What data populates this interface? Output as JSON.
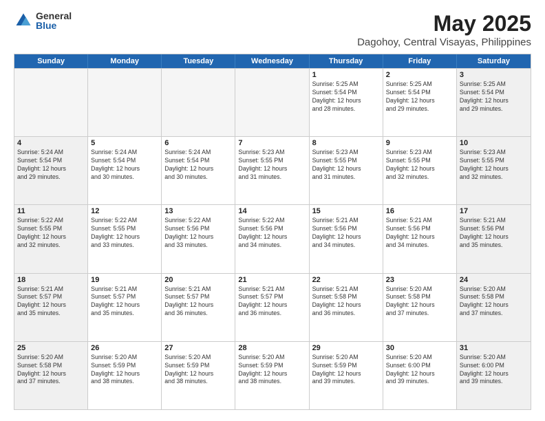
{
  "logo": {
    "general": "General",
    "blue": "Blue"
  },
  "title": "May 2025",
  "subtitle": "Dagohoy, Central Visayas, Philippines",
  "header_days": [
    "Sunday",
    "Monday",
    "Tuesday",
    "Wednesday",
    "Thursday",
    "Friday",
    "Saturday"
  ],
  "rows": [
    [
      {
        "day": "",
        "info": "",
        "empty": true
      },
      {
        "day": "",
        "info": "",
        "empty": true
      },
      {
        "day": "",
        "info": "",
        "empty": true
      },
      {
        "day": "",
        "info": "",
        "empty": true
      },
      {
        "day": "1",
        "info": "Sunrise: 5:25 AM\nSunset: 5:54 PM\nDaylight: 12 hours\nand 28 minutes."
      },
      {
        "day": "2",
        "info": "Sunrise: 5:25 AM\nSunset: 5:54 PM\nDaylight: 12 hours\nand 29 minutes."
      },
      {
        "day": "3",
        "info": "Sunrise: 5:25 AM\nSunset: 5:54 PM\nDaylight: 12 hours\nand 29 minutes."
      }
    ],
    [
      {
        "day": "4",
        "info": "Sunrise: 5:24 AM\nSunset: 5:54 PM\nDaylight: 12 hours\nand 29 minutes."
      },
      {
        "day": "5",
        "info": "Sunrise: 5:24 AM\nSunset: 5:54 PM\nDaylight: 12 hours\nand 30 minutes."
      },
      {
        "day": "6",
        "info": "Sunrise: 5:24 AM\nSunset: 5:54 PM\nDaylight: 12 hours\nand 30 minutes."
      },
      {
        "day": "7",
        "info": "Sunrise: 5:23 AM\nSunset: 5:55 PM\nDaylight: 12 hours\nand 31 minutes."
      },
      {
        "day": "8",
        "info": "Sunrise: 5:23 AM\nSunset: 5:55 PM\nDaylight: 12 hours\nand 31 minutes."
      },
      {
        "day": "9",
        "info": "Sunrise: 5:23 AM\nSunset: 5:55 PM\nDaylight: 12 hours\nand 32 minutes."
      },
      {
        "day": "10",
        "info": "Sunrise: 5:23 AM\nSunset: 5:55 PM\nDaylight: 12 hours\nand 32 minutes."
      }
    ],
    [
      {
        "day": "11",
        "info": "Sunrise: 5:22 AM\nSunset: 5:55 PM\nDaylight: 12 hours\nand 32 minutes."
      },
      {
        "day": "12",
        "info": "Sunrise: 5:22 AM\nSunset: 5:55 PM\nDaylight: 12 hours\nand 33 minutes."
      },
      {
        "day": "13",
        "info": "Sunrise: 5:22 AM\nSunset: 5:56 PM\nDaylight: 12 hours\nand 33 minutes."
      },
      {
        "day": "14",
        "info": "Sunrise: 5:22 AM\nSunset: 5:56 PM\nDaylight: 12 hours\nand 34 minutes."
      },
      {
        "day": "15",
        "info": "Sunrise: 5:21 AM\nSunset: 5:56 PM\nDaylight: 12 hours\nand 34 minutes."
      },
      {
        "day": "16",
        "info": "Sunrise: 5:21 AM\nSunset: 5:56 PM\nDaylight: 12 hours\nand 34 minutes."
      },
      {
        "day": "17",
        "info": "Sunrise: 5:21 AM\nSunset: 5:56 PM\nDaylight: 12 hours\nand 35 minutes."
      }
    ],
    [
      {
        "day": "18",
        "info": "Sunrise: 5:21 AM\nSunset: 5:57 PM\nDaylight: 12 hours\nand 35 minutes."
      },
      {
        "day": "19",
        "info": "Sunrise: 5:21 AM\nSunset: 5:57 PM\nDaylight: 12 hours\nand 35 minutes."
      },
      {
        "day": "20",
        "info": "Sunrise: 5:21 AM\nSunset: 5:57 PM\nDaylight: 12 hours\nand 36 minutes."
      },
      {
        "day": "21",
        "info": "Sunrise: 5:21 AM\nSunset: 5:57 PM\nDaylight: 12 hours\nand 36 minutes."
      },
      {
        "day": "22",
        "info": "Sunrise: 5:21 AM\nSunset: 5:58 PM\nDaylight: 12 hours\nand 36 minutes."
      },
      {
        "day": "23",
        "info": "Sunrise: 5:20 AM\nSunset: 5:58 PM\nDaylight: 12 hours\nand 37 minutes."
      },
      {
        "day": "24",
        "info": "Sunrise: 5:20 AM\nSunset: 5:58 PM\nDaylight: 12 hours\nand 37 minutes."
      }
    ],
    [
      {
        "day": "25",
        "info": "Sunrise: 5:20 AM\nSunset: 5:58 PM\nDaylight: 12 hours\nand 37 minutes."
      },
      {
        "day": "26",
        "info": "Sunrise: 5:20 AM\nSunset: 5:59 PM\nDaylight: 12 hours\nand 38 minutes."
      },
      {
        "day": "27",
        "info": "Sunrise: 5:20 AM\nSunset: 5:59 PM\nDaylight: 12 hours\nand 38 minutes."
      },
      {
        "day": "28",
        "info": "Sunrise: 5:20 AM\nSunset: 5:59 PM\nDaylight: 12 hours\nand 38 minutes."
      },
      {
        "day": "29",
        "info": "Sunrise: 5:20 AM\nSunset: 5:59 PM\nDaylight: 12 hours\nand 39 minutes."
      },
      {
        "day": "30",
        "info": "Sunrise: 5:20 AM\nSunset: 6:00 PM\nDaylight: 12 hours\nand 39 minutes."
      },
      {
        "day": "31",
        "info": "Sunrise: 5:20 AM\nSunset: 6:00 PM\nDaylight: 12 hours\nand 39 minutes."
      }
    ]
  ]
}
